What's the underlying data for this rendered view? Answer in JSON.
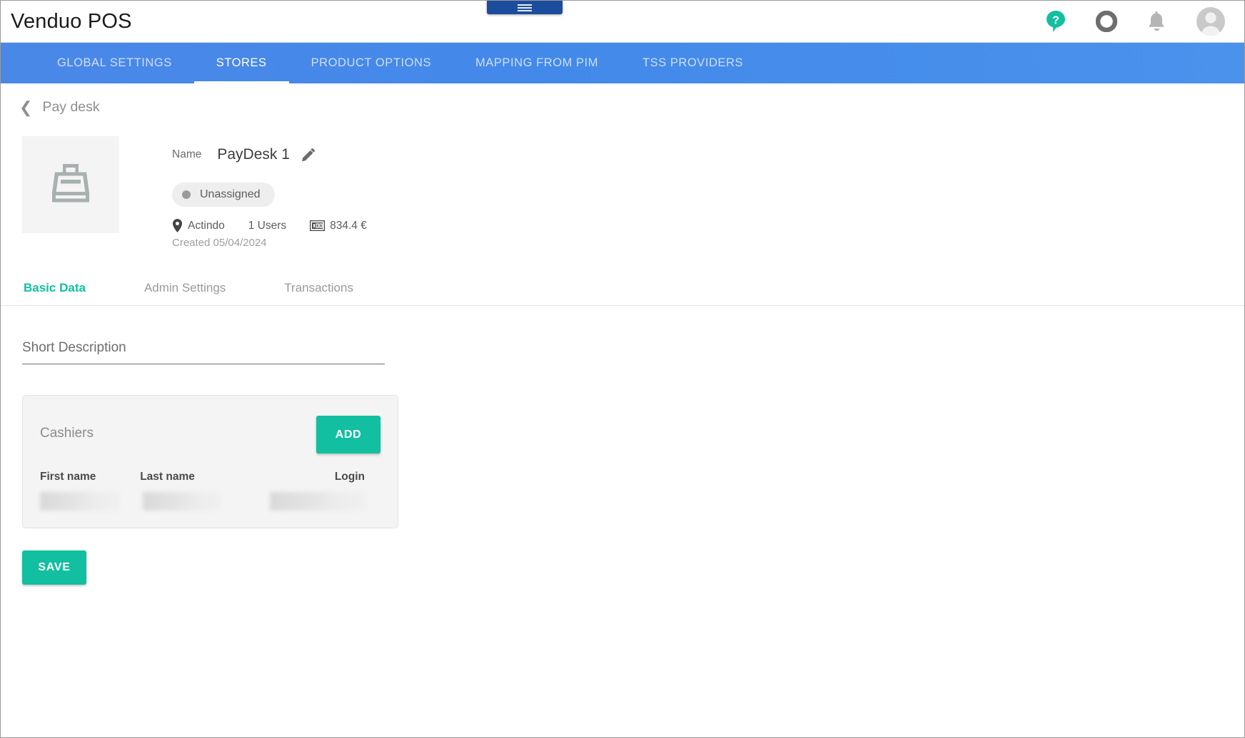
{
  "app": {
    "brand": "Venduo POS",
    "menu_tab_icon": "hamburger-menu-icon"
  },
  "topbar": {
    "icons": [
      {
        "name": "help-icon",
        "label": "?",
        "color": "#12bfa0"
      },
      {
        "name": "status-ring-icon",
        "label": "",
        "color": "#6e6e6e"
      },
      {
        "name": "notifications-bell-icon",
        "label": "",
        "color": "#b5b5b5"
      },
      {
        "name": "user-avatar-icon",
        "label": "",
        "color": "#c9c9c9"
      }
    ]
  },
  "nav": {
    "items": [
      {
        "label": "GLOBAL SETTINGS",
        "active": false
      },
      {
        "label": "STORES",
        "active": true
      },
      {
        "label": "PRODUCT OPTIONS",
        "active": false
      },
      {
        "label": "MAPPING FROM PIM",
        "active": false
      },
      {
        "label": "TSS PROVIDERS",
        "active": false
      }
    ]
  },
  "breadcrumb": {
    "back_icon": "chevron-left-icon",
    "label": "Pay desk"
  },
  "hero": {
    "thumb_icon": "cash-register-icon",
    "name_label": "Name",
    "name_value": "PayDesk 1",
    "edit_icon": "pencil-icon",
    "status_chip": "Unassigned",
    "location_icon": "location-pin-icon",
    "location": "Actindo",
    "users": "1 Users",
    "money_icon": "banknote-icon",
    "amount": "834.4 €",
    "created": "Created 05/04/2024"
  },
  "subtabs": [
    {
      "label": "Basic Data",
      "active": true
    },
    {
      "label": "Admin Settings",
      "active": false
    },
    {
      "label": "Transactions",
      "active": false
    }
  ],
  "form": {
    "short_description": {
      "value": "",
      "placeholder": "Short Description"
    }
  },
  "cashiers_card": {
    "title": "Cashiers",
    "add_button": "ADD",
    "columns": [
      "First name",
      "Last name",
      "Login"
    ],
    "rows": [
      {
        "first_name": "",
        "last_name": "",
        "login": "",
        "redacted": true
      }
    ]
  },
  "actions": {
    "save_button": "SAVE"
  },
  "colors": {
    "accent_teal": "#12bfa0",
    "nav_blue": "#4a8ce9",
    "menu_tab_blue": "#1c4d9c"
  }
}
